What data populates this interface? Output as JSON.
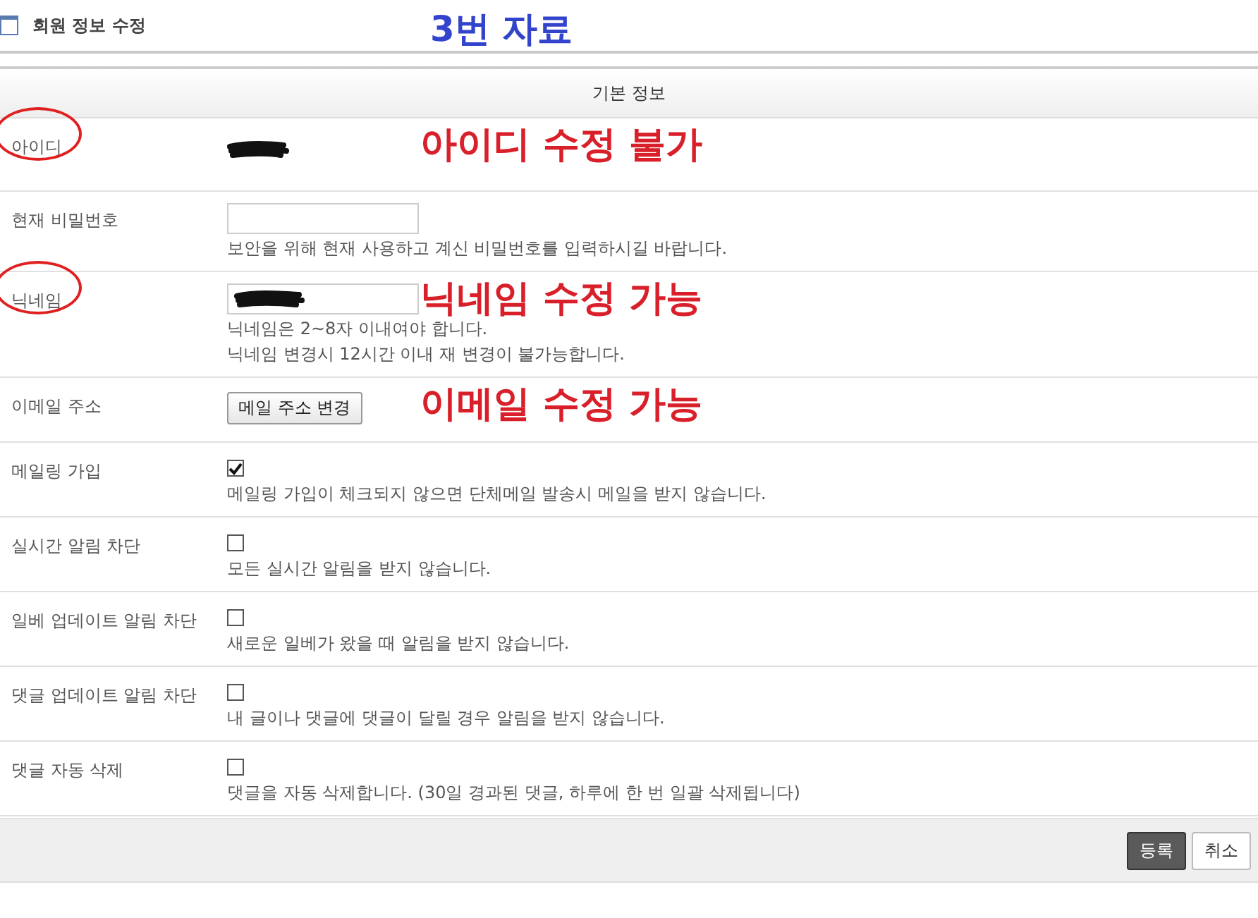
{
  "header": {
    "title": "회원 정보 수정",
    "annotation": "3번 자료"
  },
  "section_title": "기본 정보",
  "rows": [
    {
      "label": "아이디",
      "kind": "redacted_text",
      "circled": true,
      "annotation": "아이디 수정 불가"
    },
    {
      "label": "현재 비밀번호",
      "kind": "password",
      "circled": false,
      "hints": [
        "보안을 위해 현재 사용하고 계신 비밀번호를 입력하시길 바랍니다."
      ]
    },
    {
      "label": "닉네임",
      "kind": "redacted_input",
      "circled": true,
      "annotation": "닉네임 수정 가능",
      "hints": [
        "닉네임은 2~8자 이내여야 합니다.",
        "닉네임 변경시 12시간 이내 재 변경이 불가능합니다."
      ]
    },
    {
      "label": "이메일 주소",
      "kind": "button",
      "circled": false,
      "annotation": "이메일 수정 가능",
      "button_label": "메일 주소 변경"
    },
    {
      "label": "메일링 가입",
      "kind": "checkbox",
      "circled": false,
      "checked": true,
      "hints": [
        "메일링 가입이 체크되지 않으면 단체메일 발송시 메일을 받지 않습니다."
      ]
    },
    {
      "label": "실시간 알림 차단",
      "kind": "checkbox",
      "circled": false,
      "checked": false,
      "hints": [
        "모든 실시간 알림을 받지 않습니다."
      ]
    },
    {
      "label": "일베 업데이트 알림 차단",
      "kind": "checkbox",
      "circled": false,
      "checked": false,
      "hints": [
        "새로운 일베가 왔을 때 알림을 받지 않습니다."
      ]
    },
    {
      "label": "댓글 업데이트 알림 차단",
      "kind": "checkbox",
      "circled": false,
      "checked": false,
      "hints": [
        "내 글이나 댓글에 댓글이 달릴 경우 알림을 받지 않습니다."
      ]
    },
    {
      "label": "댓글 자동 삭제",
      "kind": "checkbox",
      "circled": false,
      "checked": false,
      "hints": [
        "댓글을 자동 삭제합니다. (30일 경과된 댓글, 하루에 한 번 일괄 삭제됩니다)"
      ]
    }
  ],
  "buttons": [
    {
      "label": "등록",
      "kind": "primary"
    },
    {
      "label": "취소",
      "kind": "secondary"
    }
  ]
}
